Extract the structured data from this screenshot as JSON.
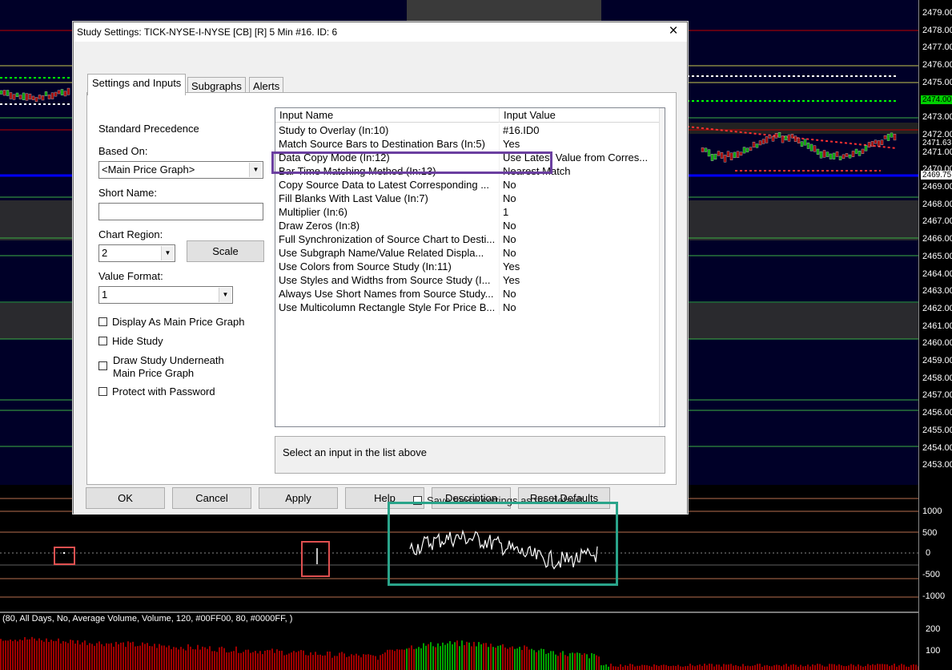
{
  "chart": {
    "price_labels": [
      "2479.00",
      "2478.00",
      "2477.00",
      "2476.00",
      "2475.00",
      "2474.00",
      "2473.00",
      "2472.00",
      "2471.00",
      "2470.00",
      "2469.00",
      "2468.00",
      "2467.00",
      "2466.00",
      "2465.00",
      "2464.00",
      "2463.00",
      "2462.00",
      "2461.00",
      "2460.00",
      "2459.00",
      "2458.00",
      "2457.00",
      "2456.00",
      "2455.00",
      "2454.00",
      "2453.00"
    ],
    "tags": [
      {
        "text": "2474.00",
        "bg": "#00d000",
        "fg": "#000"
      },
      {
        "text": "2471.63",
        "bg": "#000",
        "fg": "#fff"
      },
      {
        "text": "2469.75",
        "bg": "#fff",
        "fg": "#000"
      }
    ],
    "tick_labels": [
      "1000",
      "500",
      "0",
      "-500",
      "-1000"
    ],
    "volume_labels": [
      "200",
      "100"
    ],
    "study_legend": "(80, All Days, No, Average Volume, Volume, 120, #00FF00, 80, #0000FF, )",
    "colors": {
      "background": "#000000",
      "accent_line": "#0000ff",
      "grid_red": "#c00000",
      "up_bar": "#00a000",
      "down_bar": "#a00000"
    }
  },
  "dialog": {
    "title": "Study Settings: TICK-NYSE-I-NYSE [CB] [R]  5 Min   #16. ID: 6",
    "close_icon": "×",
    "tabs": [
      "Settings and Inputs",
      "Subgraphs",
      "Alerts"
    ],
    "standard_precedence_label": "Standard Precedence",
    "based_on_label": "Based On:",
    "based_on_value": "<Main Price Graph>",
    "short_name_label": "Short Name:",
    "short_name_value": "",
    "chart_region_label": "Chart Region:",
    "chart_region_value": "2",
    "scale_button": "Scale",
    "value_format_label": "Value Format:",
    "value_format_value": "1",
    "checkboxes": [
      {
        "label": "Display As Main Price Graph",
        "checked": false
      },
      {
        "label": "Hide Study",
        "checked": false
      },
      {
        "label": "Draw Study Underneath\nMain Price Graph",
        "checked": false
      },
      {
        "label": "Protect with Password",
        "checked": false
      }
    ],
    "grid_headers": [
      "Input Name",
      "Input Value"
    ],
    "inputs": [
      {
        "name": "Study to Overlay   (In:10)",
        "value": "#16.ID0"
      },
      {
        "name": "Match Source Bars to Destination Bars   (In:5)",
        "value": "Yes"
      },
      {
        "name": "Data Copy Mode   (In:12)",
        "value": "Use Latest Value from Corres..."
      },
      {
        "name": "Bar Time Matching Method   (In:13)",
        "value": "Nearest Match"
      },
      {
        "name": "Copy Source Data to Latest Corresponding ...",
        "value": "No"
      },
      {
        "name": "Fill Blanks With Last Value   (In:7)",
        "value": "No"
      },
      {
        "name": "Multiplier   (In:6)",
        "value": "1"
      },
      {
        "name": "Draw Zeros   (In:8)",
        "value": "No"
      },
      {
        "name": "Full Synchronization of Source Chart to Desti...",
        "value": "No"
      },
      {
        "name": "Use Subgraph Name/Value Related Displa...",
        "value": "No"
      },
      {
        "name": "Use Colors from Source Study   (In:11)",
        "value": "Yes"
      },
      {
        "name": "Use Styles and Widths from Source Study   (I...",
        "value": "Yes"
      },
      {
        "name": "Always Use Short Names from Source Study...",
        "value": "No"
      },
      {
        "name": "Use Multicolumn Rectangle Style For Price B...",
        "value": "No"
      }
    ],
    "description": "Select an input in the list above",
    "buttons": [
      "OK",
      "Cancel",
      "Apply",
      "Help",
      "Description",
      "Reset Defaults"
    ],
    "save_default_label": "Save these settings as the default"
  }
}
